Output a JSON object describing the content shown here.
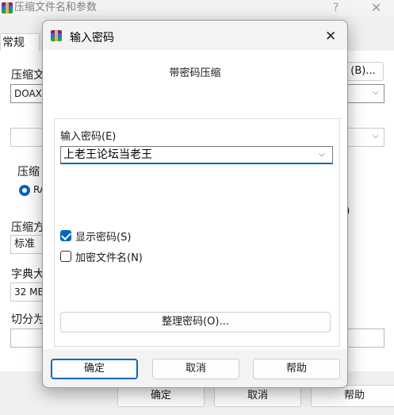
{
  "parent": {
    "title": "压缩文件名和参数",
    "help": "?",
    "close": "✕",
    "tabs": [
      "常规"
    ],
    "archive_name_label": "压缩文",
    "archive_name_value": "DOAX",
    "browse_button": "(B)...",
    "format_label": "压缩",
    "format_option": "RA",
    "method_label": "压缩方",
    "method_value": "标准",
    "dict_label": "字典大",
    "dict_value": "32 MB",
    "split_label": "切分为",
    "paren_fragment": ")",
    "ok": "确定",
    "cancel": "取消",
    "help_btn": "帮助"
  },
  "dialog": {
    "title": "输入密码",
    "heading": "带密码压缩",
    "password_label": "输入密码(E)",
    "password_value": "上老王论坛当老王",
    "show_password": {
      "label": "显示密码(S)",
      "checked": true
    },
    "encrypt_names": {
      "label": "加密文件名(N)",
      "checked": false
    },
    "organize_button": "整理密码(O)...",
    "ok": "确定",
    "cancel": "取消",
    "help": "帮助",
    "accent": "#0067c0"
  }
}
